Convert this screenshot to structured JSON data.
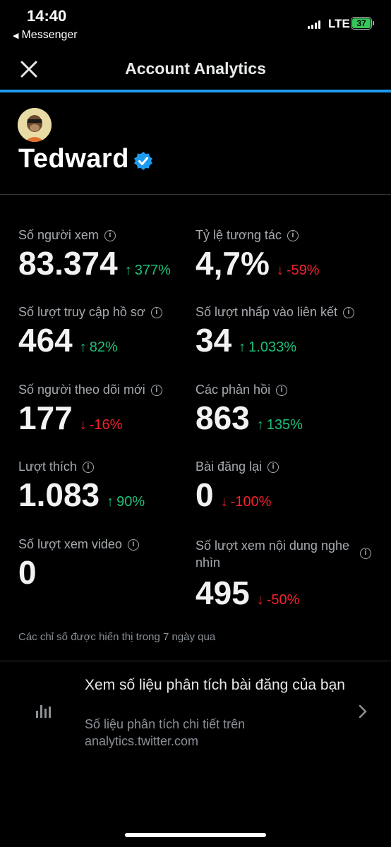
{
  "status_bar": {
    "time": "14:40",
    "back_app": "Messenger",
    "network": "LTE",
    "battery": "37"
  },
  "header": {
    "title": "Account Analytics",
    "close_icon": "close-icon"
  },
  "profile": {
    "name": "Tedward",
    "verified_icon": "verified-badge-icon",
    "avatar": "avatar"
  },
  "metrics": [
    {
      "label": "Số người xem",
      "value": "83.374",
      "delta": "377%",
      "direction": "up"
    },
    {
      "label": "Tỷ lệ tương tác",
      "value": "4,7%",
      "delta": "-59%",
      "direction": "down"
    },
    {
      "label": "Số lượt truy cập hồ sơ",
      "value": "464",
      "delta": "82%",
      "direction": "up"
    },
    {
      "label": "Số lượt nhấp vào liên kết",
      "value": "34",
      "delta": "1.033%",
      "direction": "up"
    },
    {
      "label": "Số người theo dõi mới",
      "value": "177",
      "delta": "-16%",
      "direction": "down"
    },
    {
      "label": "Các phản hồi",
      "value": "863",
      "delta": "135%",
      "direction": "up"
    },
    {
      "label": "Lượt thích",
      "value": "1.083",
      "delta": "90%",
      "direction": "up"
    },
    {
      "label": "Bài đăng lại",
      "value": "0",
      "delta": "-100%",
      "direction": "down"
    },
    {
      "label": "Số lượt xem video",
      "value": "0",
      "delta": "",
      "direction": ""
    },
    {
      "label": "Số lượt xem nội dung nghe nhìn",
      "value": "495",
      "delta": "-50%",
      "direction": "down"
    }
  ],
  "footnote": "Các chỉ số được hiển thị trong 7 ngày qua",
  "analytics_link": {
    "title": "Xem số liệu phân tích bài đăng của bạn",
    "subtitle": "Số liệu phân tích chi tiết trên analytics.twitter.com"
  },
  "colors": {
    "accent": "#1d9bf0",
    "up": "#1ec17a",
    "down": "#f4212e",
    "background": "#000000"
  }
}
